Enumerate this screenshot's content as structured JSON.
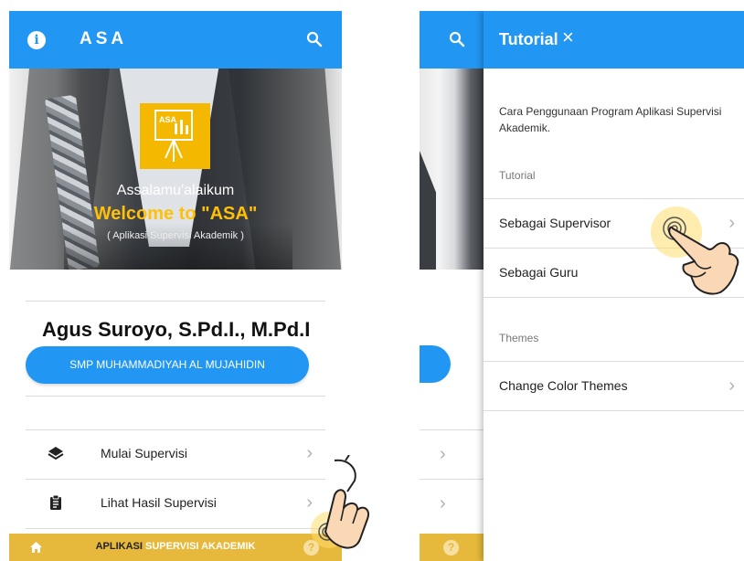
{
  "left_screen": {
    "appbar": {
      "title": "ASA",
      "info_icon": "info-circle-icon",
      "search_icon": "search-icon"
    },
    "hero": {
      "logo_text": "ASA",
      "greeting": "Assalamu'alaikum",
      "welcome": "Welcome to \"ASA\"",
      "subtitle": "( Aplikasi Supervisi Akademik )"
    },
    "user": {
      "name": "Agus Suroyo, S.Pd.I., M.Pd.I",
      "school": "SMP MUHAMMADIYAH AL MUJAHIDIN"
    },
    "menu": [
      {
        "label": "Mulai Supervisi",
        "icon": "layers-icon"
      },
      {
        "label": "Lihat Hasil Supervisi",
        "icon": "clipboard-icon"
      }
    ],
    "bottom_bar": {
      "prefix": "APLIKASI",
      "highlight": "SUPERVISI AKADEMIK",
      "home_icon": "home-icon",
      "help_icon": "help-circle-icon"
    },
    "colors": {
      "primary": "#2196f3",
      "accent": "#ffc107",
      "bottom_bar": "#e6b83b"
    }
  },
  "right_screen": {
    "drawer": {
      "title": "Tutorial",
      "close_glyph": "×",
      "description": "Cara Penggunaan Program Aplikasi Supervisi Akademik.",
      "sections": [
        {
          "heading": "Tutorial",
          "items": [
            "Sebagai Supervisor",
            "Sebagai Guru"
          ]
        },
        {
          "heading": "Themes",
          "items": [
            "Change Color Themes"
          ]
        }
      ]
    }
  }
}
